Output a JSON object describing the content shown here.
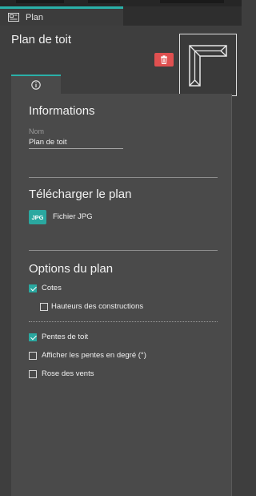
{
  "panel_tab": {
    "label": "Plan"
  },
  "header": {
    "title": "Plan de toit"
  },
  "info_section": {
    "heading": "Informations",
    "name_label": "Nom",
    "name_value": "Plan de toit"
  },
  "download_section": {
    "heading": "Télécharger le plan",
    "badge": "JPG",
    "file_label": "Fichier JPG"
  },
  "options_section": {
    "heading": "Options du plan",
    "options": [
      {
        "label": "Cotes",
        "checked": true
      },
      {
        "label": "Hauteurs des constructions",
        "checked": false
      },
      {
        "label": "Pentes de toit",
        "checked": true
      },
      {
        "label": "Afficher les pentes en degré (°)",
        "checked": false
      },
      {
        "label": "Rose des vents",
        "checked": false
      }
    ]
  },
  "colors": {
    "accent": "#2aa8a0",
    "delete": "#e05050",
    "panel": "#4a4a4a",
    "background": "#3e3e3e"
  },
  "icons": [
    "plan-icon",
    "trash-icon",
    "info-icon",
    "roof-plan-icon",
    "check-icon"
  ]
}
